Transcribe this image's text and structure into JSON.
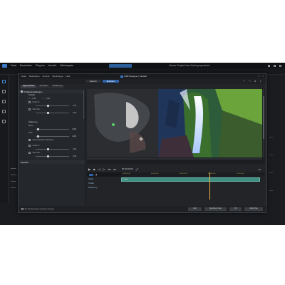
{
  "app": {
    "menu": [
      "Datei",
      "Bearbeiten",
      "Plug-ins",
      "Ansicht",
      "Wiedergabe"
    ],
    "doc_title": "Neues Projekt  Neu  Nicht gespeichert"
  },
  "dialog": {
    "menu": [
      "Datei",
      "Bearbeiten",
      "Ansicht",
      "Werkzeuge",
      "Hilfe"
    ],
    "title": "FBR Designer | Partikel",
    "toolbar": {
      "buttons": [
        "Basisch",
        "Erweitert"
      ],
      "active_index": 1
    },
    "tabs": [
      "Eigenschaften",
      "Animation",
      "Maskierung"
    ],
    "active_tab_index": 0,
    "props": {
      "section_main": "Partikeleinstellungen",
      "position_head": "Position",
      "x_label": "X",
      "x_value": "0,500",
      "y_label": "Y",
      "y_value": "0,500",
      "size_check_label": "Größe fix",
      "size_value": "0,40",
      "scale_check_label": "Stufe hält",
      "scale_value": "0,00",
      "rotation_head": "Skalierung",
      "breite_label": "Breite",
      "breite_value": "1,000",
      "hoehe_label": "Höhe",
      "hoehe_value": "1,000",
      "keep_ratio_label": "Seitenverhältnis beibehalten",
      "size2_check_label": "Größe fix",
      "size2_value": "0,00",
      "scale2_check_label": "Stufe hält",
      "scale2_value": "0,00",
      "opacity_head": "Opazität"
    },
    "transport": {
      "time": "00:00:00:00"
    },
    "timeline": {
      "ruler": [
        "00:00:00:00",
        "00:00:01:00",
        "00:00:02:00",
        "00:00:03:00",
        "00:00:04:00"
      ],
      "rows": [
        "Objekt",
        "Partikel",
        "Maskierung"
      ],
      "clip_label": "Partikel"
    },
    "footer": {
      "checkbox_label": "Alle Bearbeitungen speichern anzeigen",
      "buttons": [
        "Jetzt",
        "Speichern unter",
        "OK",
        "Abbrechen"
      ]
    }
  },
  "colors": {
    "accent": "#2f63a6",
    "clip": "#3f8f82",
    "playhead": "#f0b648"
  }
}
